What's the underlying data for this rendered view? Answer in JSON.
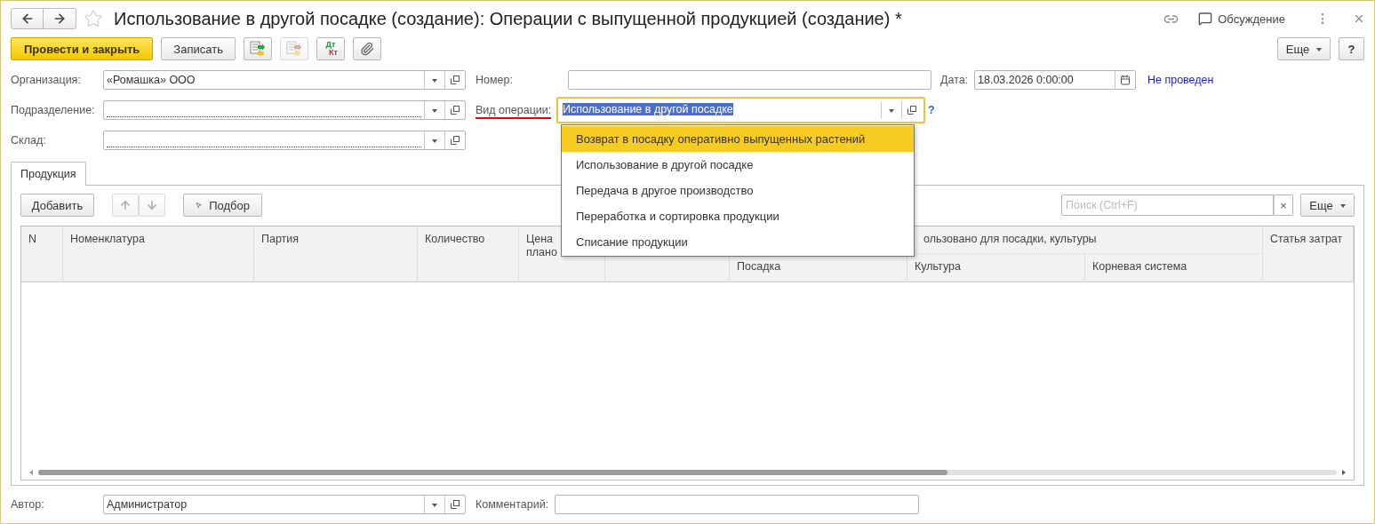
{
  "window": {
    "title": "Использование в другой посадке (создание): Операции с выпущенной продукцией (создание) *",
    "discussion": "Обсуждение"
  },
  "command_bar": {
    "buttons": [
      {
        "kind": "primary",
        "label": "Провести и закрыть",
        "disabled": false
      },
      {
        "kind": "text",
        "label": "Записать",
        "disabled": false
      },
      {
        "kind": "post",
        "disabled": false
      },
      {
        "kind": "unpost",
        "disabled": true
      },
      {
        "kind": "dtkt",
        "top": "Дт",
        "bottom": "Кт",
        "disabled": false
      },
      {
        "kind": "attach",
        "disabled": false
      }
    ],
    "more": "Еще",
    "help": "?"
  },
  "fields_left": [
    {
      "label": "Организация:",
      "value": "«Ромашка» ООО",
      "invalid": false
    },
    {
      "label": "Подразделение:",
      "invalid": true
    },
    {
      "label": "Склад:",
      "invalid": true
    }
  ],
  "number": {
    "label": "Номер:"
  },
  "date": {
    "label": "Дата:",
    "value": "18.03.2026  0:00:00"
  },
  "status_link": "Не проведен",
  "operation": {
    "label": "Вид операции:",
    "value": "Использование в другой посадке",
    "focused": true,
    "help": "?"
  },
  "operation_menu": [
    {
      "label": "Возврат в посадку оперативно выпущенных растений",
      "selected": true
    },
    {
      "label": "Использование в другой посадке",
      "selected": false
    },
    {
      "label": "Передача в другое производство",
      "selected": false
    },
    {
      "label": "Переработка и сортировка продукции",
      "selected": false
    },
    {
      "label": "Списание продукции",
      "selected": false
    }
  ],
  "tabs": [
    {
      "label": "Продукция",
      "selected": true
    }
  ],
  "table_toolbar": {
    "add": "Добавить",
    "pick": "Подбор",
    "search_placeholder": "Поиск (Ctrl+F)",
    "clear": "×",
    "more": "Еще",
    "move_disabled": true
  },
  "table": {
    "columns": [
      {
        "label": "N"
      },
      {
        "label": "Номенклатура"
      },
      {
        "label": "Партия"
      },
      {
        "label": "Количество"
      },
      {
        "label": "Цена\nплано"
      }
    ],
    "group": {
      "label": "ользовано для посадки, культуры",
      "columns": [
        "Посадка",
        "Культура",
        "Корневая система"
      ]
    },
    "last_column": "Статья затрат"
  },
  "footer": {
    "author_label": "Автор:",
    "author": "Администратор",
    "comment_label": "Комментарий:"
  }
}
